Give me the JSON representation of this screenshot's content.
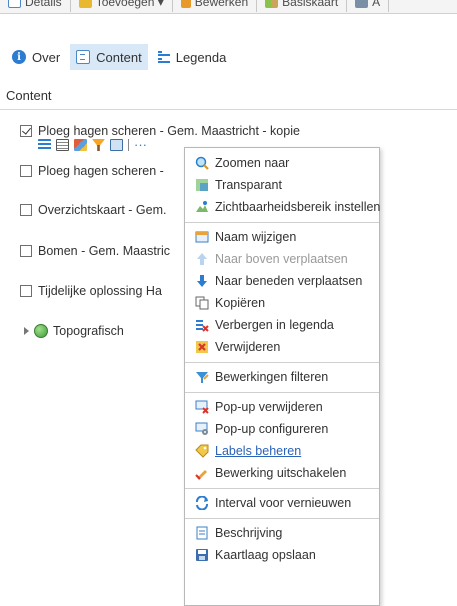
{
  "toolbar": {
    "items": [
      {
        "label": "Details"
      },
      {
        "label": "Toevoegen ▾"
      },
      {
        "label": "Bewerken"
      },
      {
        "label": "Basiskaart"
      },
      {
        "label": "A"
      }
    ]
  },
  "tabs": [
    {
      "label": "Over",
      "icon": "info-icon"
    },
    {
      "label": "Content",
      "icon": "content-icon",
      "active": true
    },
    {
      "label": "Legenda",
      "icon": "legend-icon"
    }
  ],
  "section_title": "Content",
  "layers": [
    {
      "label": "Ploeg hagen scheren - Gem. Maastricht - kopie",
      "checked": true
    },
    {
      "label": "Ploeg hagen scheren -",
      "checked": false
    },
    {
      "label": "Overzichtskaart - Gem.",
      "checked": false
    },
    {
      "label": "Bomen - Gem. Maastric",
      "checked": false
    },
    {
      "label": "Tijdelijke oplossing Ha",
      "checked": false
    }
  ],
  "basemap": {
    "label": "Topografisch"
  },
  "context_menu": {
    "items": [
      {
        "label": "Zoomen naar",
        "icon": "zoom-icon"
      },
      {
        "label": "Transparant",
        "icon": "transparency-icon"
      },
      {
        "label": "Zichtbaarheidsbereik instellen",
        "icon": "visibility-range-icon"
      },
      {
        "label": "Naam wijzigen",
        "icon": "rename-icon"
      },
      {
        "label": "Naar boven verplaatsen",
        "icon": "arrow-up-icon",
        "disabled": true
      },
      {
        "label": "Naar beneden verplaatsen",
        "icon": "arrow-down-icon"
      },
      {
        "label": "Kopiëren",
        "icon": "copy-icon"
      },
      {
        "label": "Verbergen in legenda",
        "icon": "hide-legend-icon"
      },
      {
        "label": "Verwijderen",
        "icon": "remove-icon"
      },
      {
        "label": "Bewerkingen filteren",
        "icon": "filter-edits-icon"
      },
      {
        "label": "Pop-up verwijderen",
        "icon": "remove-popup-icon"
      },
      {
        "label": "Pop-up configureren",
        "icon": "configure-popup-icon"
      },
      {
        "label": "Labels beheren",
        "icon": "labels-icon",
        "hovered": true
      },
      {
        "label": "Bewerking uitschakelen",
        "icon": "disable-editing-icon"
      },
      {
        "label": "Interval voor vernieuwen",
        "icon": "refresh-icon"
      },
      {
        "label": "Beschrijving",
        "icon": "description-icon"
      },
      {
        "label": "Kaartlaag opslaan",
        "icon": "save-icon"
      }
    ]
  },
  "colors": {
    "accent": "#2c7dd0",
    "active_tab_bg": "#d8e8f6",
    "link": "#2c62b8"
  }
}
